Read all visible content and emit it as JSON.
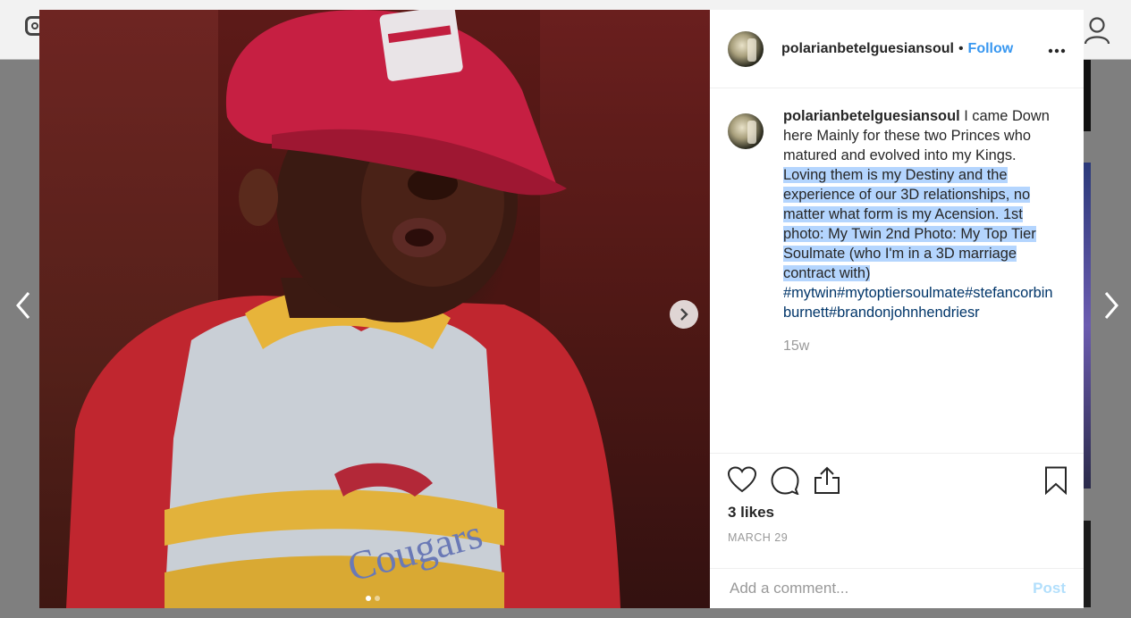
{
  "post": {
    "username": "polarianbetelguesiansoul",
    "separator": "•",
    "follow_label": "Follow",
    "caption_lead": "I came Down here Mainly for these two Princes who matured and evolved into my Kings.",
    "caption_highlight": "Loving them is my Destiny and the experience of our 3D relationships, no matter what form is my Acension. 1st photo: My Twin 2nd Photo: My Top Tier Soulmate (who I'm in a 3D marriage contract with)",
    "hashtags": "#mytwin#mytoptiersoulmate#stefancorbinburnett#brandonjohnhendriesr",
    "time_ago": "15w",
    "likes": "3 likes",
    "date": "MARCH 29"
  },
  "comment": {
    "placeholder": "Add a comment...",
    "post_label": "Post"
  },
  "carousel": {
    "count": 2,
    "active": 1
  },
  "colors": {
    "link": "#3897f0",
    "hashtag": "#003569",
    "selection": "#b4d5fe",
    "muted": "#999999"
  },
  "icons": [
    "instagram-icon",
    "profile-icon",
    "prev-arrow-icon",
    "next-arrow-icon",
    "chevron-right-icon",
    "more-options-icon",
    "heart-icon",
    "comment-icon",
    "share-icon",
    "bookmark-icon"
  ]
}
